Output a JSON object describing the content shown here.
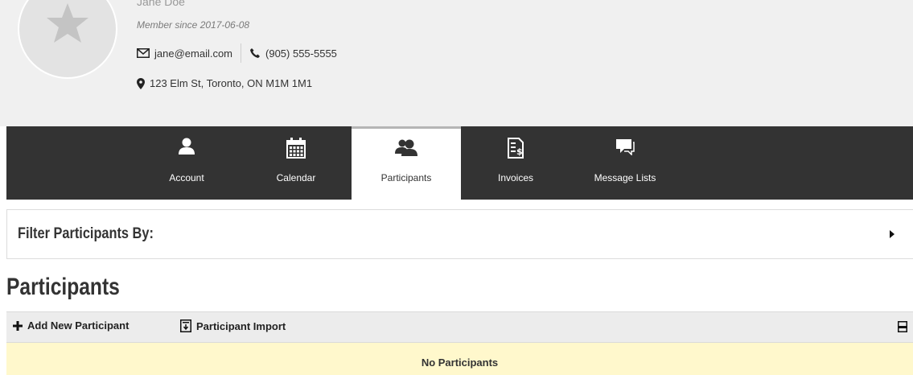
{
  "profile": {
    "name": "Jane Doe",
    "member_since": "Member since 2017-06-08",
    "email": "jane@email.com",
    "phone": "(905) 555-5555",
    "address": "123 Elm St, Toronto, ON M1M 1M1"
  },
  "tabs": [
    {
      "label": "Account",
      "icon": "user-icon"
    },
    {
      "label": "Calendar",
      "icon": "calendar-icon"
    },
    {
      "label": "Participants",
      "icon": "participants-icon",
      "active": true
    },
    {
      "label": "Invoices",
      "icon": "invoice-icon"
    },
    {
      "label": "Message Lists",
      "icon": "message-icon"
    }
  ],
  "filter": {
    "title": "Filter Participants By:"
  },
  "section": {
    "title": "Participants",
    "add_label": "Add New Participant",
    "import_label": "Participant Import",
    "empty_text": "No Participants"
  },
  "colors": {
    "tabbar_bg": "#333333",
    "profile_bg": "#f0f0f0",
    "empty_bg": "#fff8cc"
  }
}
